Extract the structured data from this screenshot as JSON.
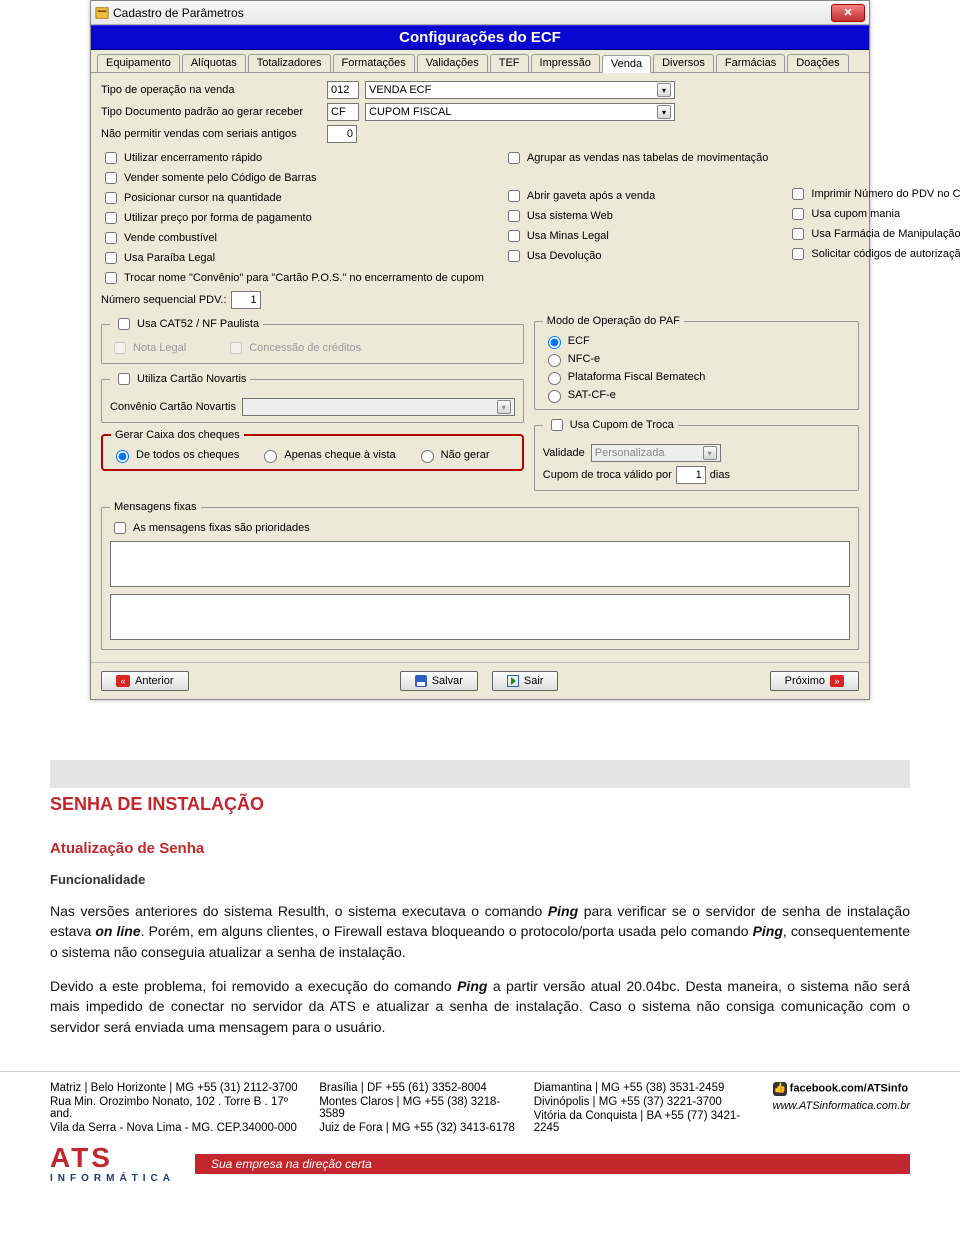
{
  "window": {
    "title": "Cadastro de Parâmetros",
    "banner": "Configurações do ECF",
    "tabs": [
      "Equipamento",
      "Alíquotas",
      "Totalizadores",
      "Formatações",
      "Validações",
      "TEF",
      "Impressão",
      "Venda",
      "Diversos",
      "Farmácias",
      "Doações"
    ],
    "active_tab": "Venda"
  },
  "form": {
    "tipo_operacao_label": "Tipo de operação na venda",
    "tipo_operacao_code": "012",
    "tipo_operacao_value": "VENDA ECF",
    "tipo_doc_label": "Tipo Documento padrão ao gerar receber",
    "tipo_doc_code": "CF",
    "tipo_doc_value": "CUPOM FISCAL",
    "nao_permitir_label": "Não permitir vendas com seriais antigos",
    "nao_permitir_value": "0",
    "col1": [
      "Utilizar encerramento rápido",
      "Vender somente pelo Código de Barras",
      "Posicionar cursor na quantidade",
      "Utilizar preço por forma de pagamento",
      "Vende combustível",
      "Usa Paraíba Legal",
      "Trocar nome \"Convênio\" para \"Cartão P.O.S.\" no encerramento de cupom"
    ],
    "col2": [
      "Agrupar as vendas nas tabelas de movimentação",
      "Abrir gaveta após a venda",
      "Usa sistema Web",
      "Usa Minas Legal",
      "Usa Devolução"
    ],
    "col3": [
      "Imprimir Número do PDV no Cupom",
      "Usa cupom mania",
      "Usa Farmácia de Manipulação",
      "Solicitar códigos de autorização de vendas com cartão"
    ],
    "seq_pdv_label": "Número sequencial PDV.:",
    "seq_pdv_value": "1",
    "cat52_label": "Usa CAT52 / NF Paulista",
    "nota_legal_label": "Nota Legal",
    "concessao_label": "Concessão de créditos",
    "novartis_chk": "Utiliza Cartão Novartis",
    "novartis_label": "Convênio Cartão Novartis",
    "paf_legend": "Modo de Operação do PAF",
    "paf_options": [
      "ECF",
      "NFC-e",
      "Plataforma Fiscal Bematech",
      "SAT-CF-e"
    ],
    "paf_selected": "ECF",
    "troca_legend": "Usa Cupom de Troca",
    "troca_validade_label": "Validade",
    "troca_validade_value": "Personalizada",
    "troca_valido_label": "Cupom de troca válido por",
    "troca_valido_value": "1",
    "troca_dias": "dias",
    "cheques_legend": "Gerar Caixa dos cheques",
    "cheques_options": [
      "De todos os cheques",
      "Apenas cheque à vista",
      "Não gerar"
    ],
    "cheques_selected": "De todos os cheques",
    "msg_legend": "Mensagens fixas",
    "msg_chk": "As mensagens fixas são prioridades"
  },
  "buttons": {
    "anterior": "Anterior",
    "salvar": "Salvar",
    "sair": "Sair",
    "proximo": "Próximo"
  },
  "doc": {
    "h1": "SENHA DE INSTALAÇÃO",
    "h2": "Atualização de Senha",
    "h3": "Funcionalidade",
    "p1a": "Nas versões anteriores do sistema Resulth, o sistema executava o comando ",
    "p1b": "Ping",
    "p1c": " para verificar se o servidor de senha de instalação estava ",
    "p1d": "on line",
    "p1e": ". Porém, em alguns clientes, o Firewall estava bloqueando o protocolo/porta usada pelo comando ",
    "p1f": "Ping",
    "p1g": ", consequentemente o sistema não conseguia atualizar a senha de instalação.",
    "p2a": "Devido a este problema, foi removido a execução do comando ",
    "p2b": "Ping",
    "p2c": " a partir versão atual 20.04bc. Desta maneira, o sistema não será mais impedido de conectar no servidor da ATS e atualizar a senha de instalação. Caso o sistema não consiga comunicação com o servidor será enviada uma mensagem para o usuário."
  },
  "footer": {
    "c1": [
      "Matriz | Belo Horizonte | MG   +55 (31) 2112-3700",
      "Rua Min. Orozimbo Nonato, 102 . Torre B . 17º and.",
      "Vila da Serra - Nova Lima - MG. CEP.34000-000"
    ],
    "c2": [
      "Brasília | DF             +55 (61) 3352-8004",
      "Montes Claros | MG   +55 (38) 3218-3589",
      "Juiz de Fora | MG       +55 (32) 3413-6178"
    ],
    "c3": [
      "Diamantina | MG               +55 (38) 3531-2459",
      "Divinópolis | MG               +55 (37) 3221-3700",
      "Vitória da Conquista | BA  +55 (77) 3421-2245"
    ],
    "fb": "facebook.com/ATSinfo",
    "site": "www.ATSinformatica.com.br"
  },
  "brand": {
    "logo_top": "ATS",
    "logo_bot": "INFORMÁTICA",
    "tagline": "Sua empresa na direção certa"
  }
}
